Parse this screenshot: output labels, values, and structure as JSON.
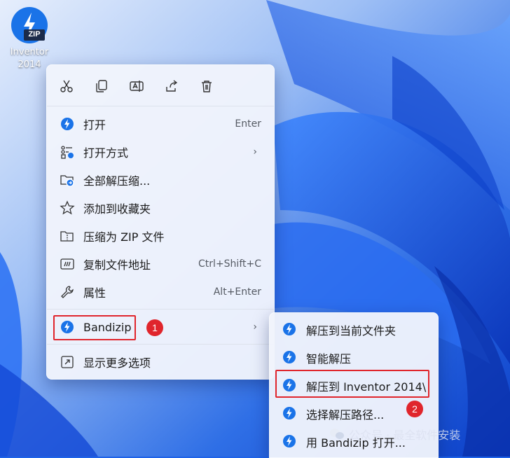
{
  "desktop": {
    "file_icon_text": "ZIP",
    "file_name_line1": "Inventor",
    "file_name_line2": "2014"
  },
  "context_menu": {
    "toolbar": [
      "cut-icon",
      "copy-icon",
      "rename-icon",
      "share-icon",
      "delete-icon"
    ],
    "items": [
      {
        "label": "打开",
        "shortcut": "Enter",
        "icon": "bandizip-icon"
      },
      {
        "label": "打开方式",
        "shortcut": "",
        "icon": "open-with-icon",
        "submenu": true
      },
      {
        "label": "全部解压缩...",
        "shortcut": "",
        "icon": "extract-all-icon"
      },
      {
        "label": "添加到收藏夹",
        "shortcut": "",
        "icon": "star-icon"
      },
      {
        "label": "压缩为 ZIP 文件",
        "shortcut": "",
        "icon": "zip-folder-icon"
      },
      {
        "label": "复制文件地址",
        "shortcut": "Ctrl+Shift+C",
        "icon": "copy-path-icon"
      },
      {
        "label": "属性",
        "shortcut": "Alt+Enter",
        "icon": "wrench-icon"
      },
      {
        "label": "Bandizip",
        "shortcut": "",
        "icon": "bandizip-icon",
        "submenu": true
      },
      {
        "label": "显示更多选项",
        "shortcut": "",
        "icon": "more-options-icon"
      }
    ],
    "arrow_glyph": "›"
  },
  "submenu": {
    "items": [
      {
        "label": "解压到当前文件夹"
      },
      {
        "label": "智能解压"
      },
      {
        "label": "解压到 Inventor 2014\\"
      },
      {
        "label": "选择解压路径..."
      },
      {
        "label": "用 Bandizip 打开..."
      }
    ]
  },
  "annotations": {
    "badge_1": "1",
    "badge_2": "2",
    "accent_color": "#e0252c"
  },
  "watermark": {
    "text": "公众号 · 最全软件安装"
  },
  "colors": {
    "bandizip_blue": "#1a73e8",
    "menu_bg": "#f0f4fc"
  }
}
